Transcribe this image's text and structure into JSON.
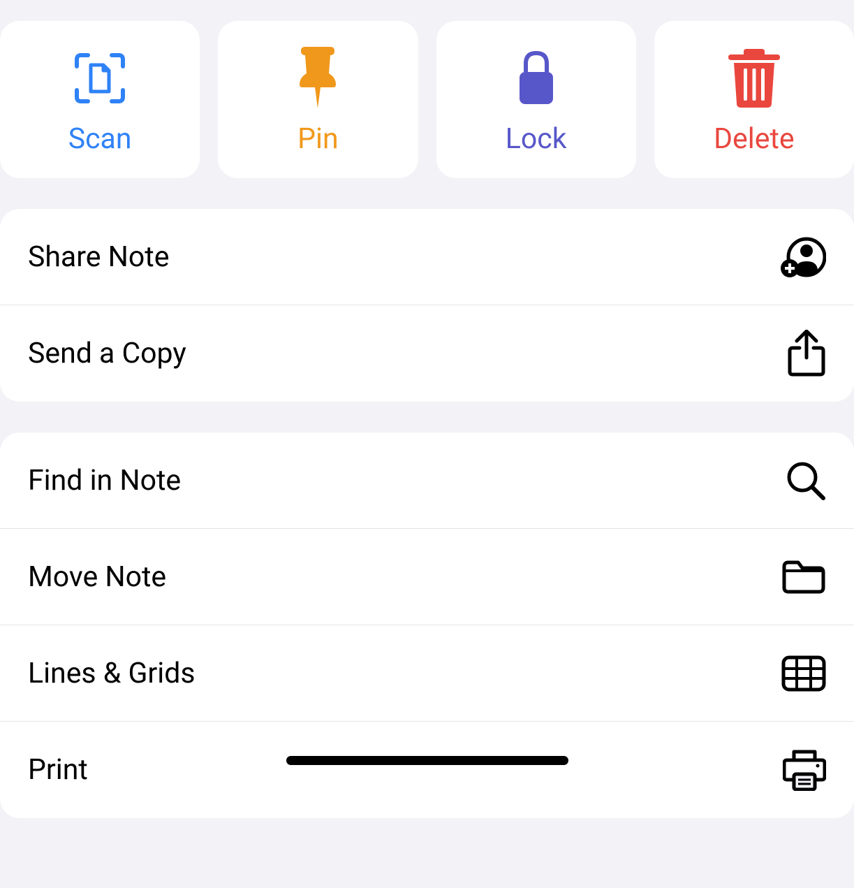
{
  "topActions": {
    "scan": {
      "label": "Scan",
      "color": "#2f82f6"
    },
    "pin": {
      "label": "Pin",
      "color": "#f0981c"
    },
    "lock": {
      "label": "Lock",
      "color": "#5757c9"
    },
    "delete": {
      "label": "Delete",
      "color": "#e9473e"
    }
  },
  "groups": [
    {
      "items": [
        {
          "label": "Share Note",
          "icon": "share-person"
        },
        {
          "label": "Send a Copy",
          "icon": "share-arrow"
        }
      ]
    },
    {
      "items": [
        {
          "label": "Find in Note",
          "icon": "search"
        },
        {
          "label": "Move Note",
          "icon": "folder"
        },
        {
          "label": "Lines & Grids",
          "icon": "grid"
        },
        {
          "label": "Print",
          "icon": "print"
        }
      ]
    }
  ]
}
